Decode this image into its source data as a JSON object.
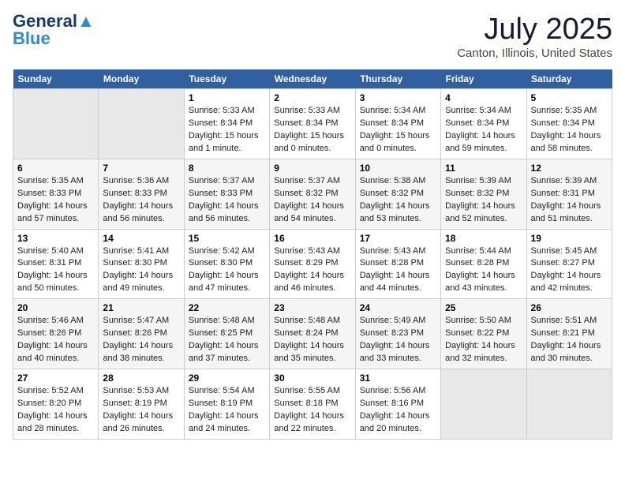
{
  "header": {
    "logo_general": "General",
    "logo_blue": "Blue",
    "main_title": "July 2025",
    "subtitle": "Canton, Illinois, United States"
  },
  "days_of_week": [
    "Sunday",
    "Monday",
    "Tuesday",
    "Wednesday",
    "Thursday",
    "Friday",
    "Saturday"
  ],
  "weeks": [
    {
      "days": [
        {
          "date": "",
          "info": ""
        },
        {
          "date": "",
          "info": ""
        },
        {
          "date": "1",
          "info": "Sunrise: 5:33 AM\nSunset: 8:34 PM\nDaylight: 15 hours\nand 1 minute."
        },
        {
          "date": "2",
          "info": "Sunrise: 5:33 AM\nSunset: 8:34 PM\nDaylight: 15 hours\nand 0 minutes."
        },
        {
          "date": "3",
          "info": "Sunrise: 5:34 AM\nSunset: 8:34 PM\nDaylight: 15 hours\nand 0 minutes."
        },
        {
          "date": "4",
          "info": "Sunrise: 5:34 AM\nSunset: 8:34 PM\nDaylight: 14 hours\nand 59 minutes."
        },
        {
          "date": "5",
          "info": "Sunrise: 5:35 AM\nSunset: 8:34 PM\nDaylight: 14 hours\nand 58 minutes."
        }
      ]
    },
    {
      "days": [
        {
          "date": "6",
          "info": "Sunrise: 5:35 AM\nSunset: 8:33 PM\nDaylight: 14 hours\nand 57 minutes."
        },
        {
          "date": "7",
          "info": "Sunrise: 5:36 AM\nSunset: 8:33 PM\nDaylight: 14 hours\nand 56 minutes."
        },
        {
          "date": "8",
          "info": "Sunrise: 5:37 AM\nSunset: 8:33 PM\nDaylight: 14 hours\nand 56 minutes."
        },
        {
          "date": "9",
          "info": "Sunrise: 5:37 AM\nSunset: 8:32 PM\nDaylight: 14 hours\nand 54 minutes."
        },
        {
          "date": "10",
          "info": "Sunrise: 5:38 AM\nSunset: 8:32 PM\nDaylight: 14 hours\nand 53 minutes."
        },
        {
          "date": "11",
          "info": "Sunrise: 5:39 AM\nSunset: 8:32 PM\nDaylight: 14 hours\nand 52 minutes."
        },
        {
          "date": "12",
          "info": "Sunrise: 5:39 AM\nSunset: 8:31 PM\nDaylight: 14 hours\nand 51 minutes."
        }
      ]
    },
    {
      "days": [
        {
          "date": "13",
          "info": "Sunrise: 5:40 AM\nSunset: 8:31 PM\nDaylight: 14 hours\nand 50 minutes."
        },
        {
          "date": "14",
          "info": "Sunrise: 5:41 AM\nSunset: 8:30 PM\nDaylight: 14 hours\nand 49 minutes."
        },
        {
          "date": "15",
          "info": "Sunrise: 5:42 AM\nSunset: 8:30 PM\nDaylight: 14 hours\nand 47 minutes."
        },
        {
          "date": "16",
          "info": "Sunrise: 5:43 AM\nSunset: 8:29 PM\nDaylight: 14 hours\nand 46 minutes."
        },
        {
          "date": "17",
          "info": "Sunrise: 5:43 AM\nSunset: 8:28 PM\nDaylight: 14 hours\nand 44 minutes."
        },
        {
          "date": "18",
          "info": "Sunrise: 5:44 AM\nSunset: 8:28 PM\nDaylight: 14 hours\nand 43 minutes."
        },
        {
          "date": "19",
          "info": "Sunrise: 5:45 AM\nSunset: 8:27 PM\nDaylight: 14 hours\nand 42 minutes."
        }
      ]
    },
    {
      "days": [
        {
          "date": "20",
          "info": "Sunrise: 5:46 AM\nSunset: 8:26 PM\nDaylight: 14 hours\nand 40 minutes."
        },
        {
          "date": "21",
          "info": "Sunrise: 5:47 AM\nSunset: 8:26 PM\nDaylight: 14 hours\nand 38 minutes."
        },
        {
          "date": "22",
          "info": "Sunrise: 5:48 AM\nSunset: 8:25 PM\nDaylight: 14 hours\nand 37 minutes."
        },
        {
          "date": "23",
          "info": "Sunrise: 5:48 AM\nSunset: 8:24 PM\nDaylight: 14 hours\nand 35 minutes."
        },
        {
          "date": "24",
          "info": "Sunrise: 5:49 AM\nSunset: 8:23 PM\nDaylight: 14 hours\nand 33 minutes."
        },
        {
          "date": "25",
          "info": "Sunrise: 5:50 AM\nSunset: 8:22 PM\nDaylight: 14 hours\nand 32 minutes."
        },
        {
          "date": "26",
          "info": "Sunrise: 5:51 AM\nSunset: 8:21 PM\nDaylight: 14 hours\nand 30 minutes."
        }
      ]
    },
    {
      "days": [
        {
          "date": "27",
          "info": "Sunrise: 5:52 AM\nSunset: 8:20 PM\nDaylight: 14 hours\nand 28 minutes."
        },
        {
          "date": "28",
          "info": "Sunrise: 5:53 AM\nSunset: 8:19 PM\nDaylight: 14 hours\nand 26 minutes."
        },
        {
          "date": "29",
          "info": "Sunrise: 5:54 AM\nSunset: 8:19 PM\nDaylight: 14 hours\nand 24 minutes."
        },
        {
          "date": "30",
          "info": "Sunrise: 5:55 AM\nSunset: 8:18 PM\nDaylight: 14 hours\nand 22 minutes."
        },
        {
          "date": "31",
          "info": "Sunrise: 5:56 AM\nSunset: 8:16 PM\nDaylight: 14 hours\nand 20 minutes."
        },
        {
          "date": "",
          "info": ""
        },
        {
          "date": "",
          "info": ""
        }
      ]
    }
  ]
}
